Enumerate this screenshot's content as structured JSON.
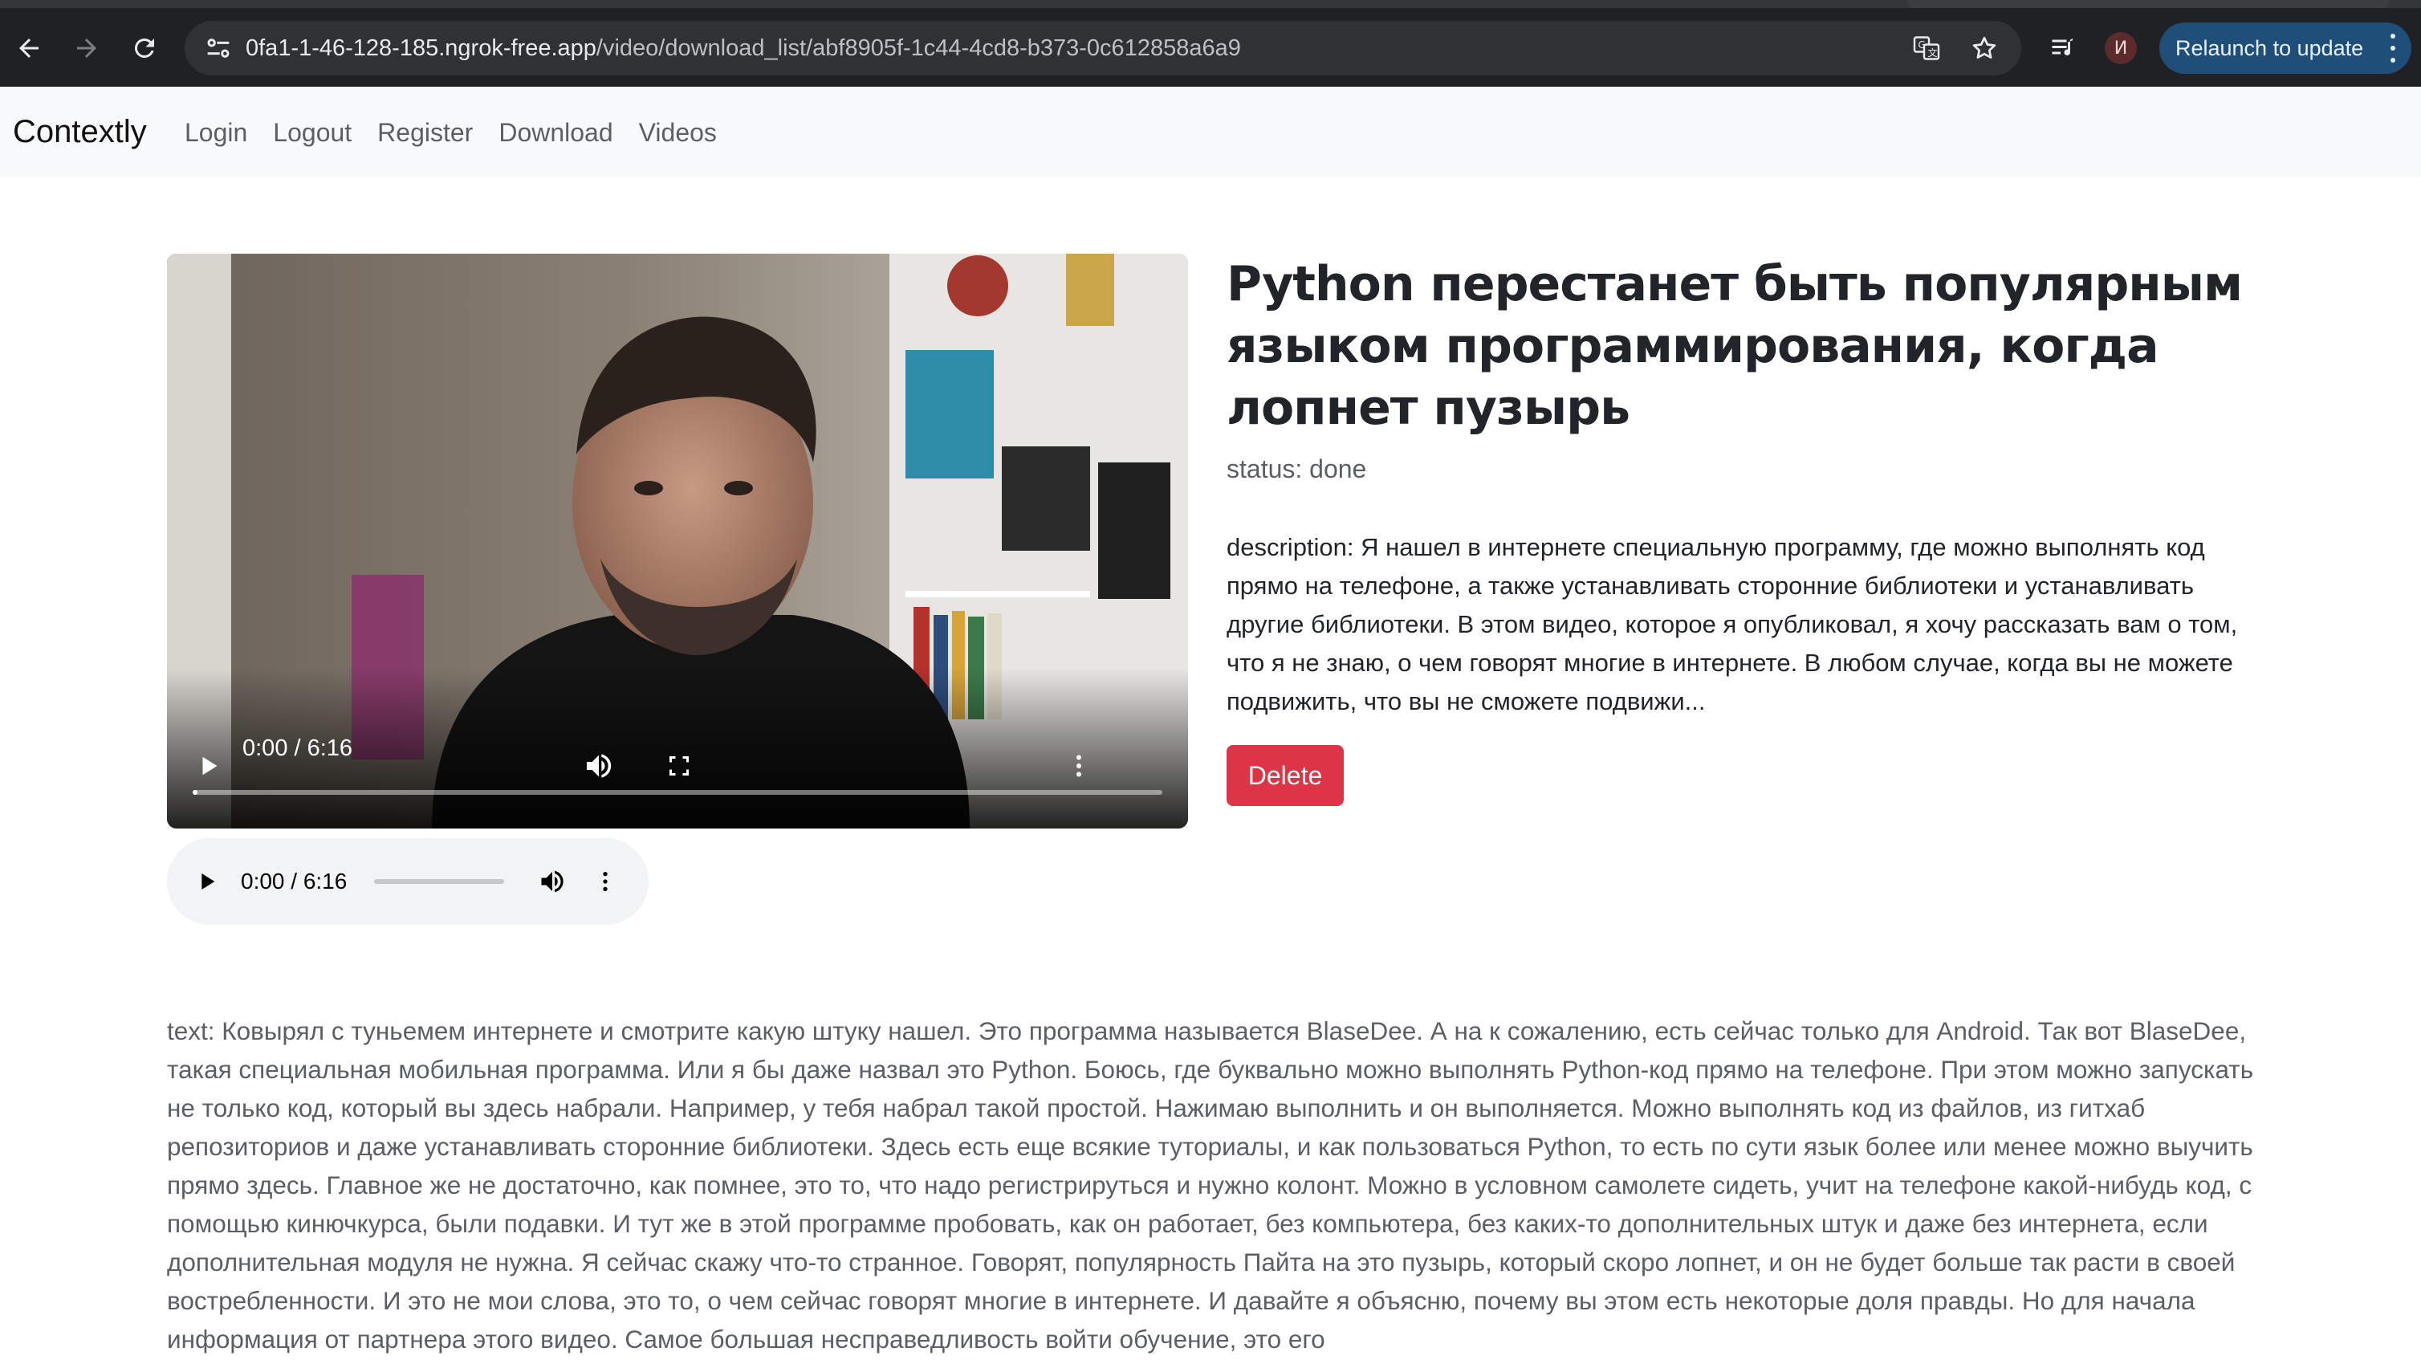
{
  "browser": {
    "url_host": "0fa1-1-46-128-185.ngrok-free.app",
    "url_path": "/video/download_list/abf8905f-1c44-4cd8-b373-0c612858a6a9",
    "profile_initial": "И",
    "relaunch_label": "Relaunch to update"
  },
  "navbar": {
    "brand": "Contextly",
    "links": [
      "Login",
      "Logout",
      "Register",
      "Download",
      "Videos"
    ]
  },
  "video": {
    "time": "0:00 / 6:16",
    "progress": 0.005
  },
  "audio": {
    "time": "0:00 / 6:16",
    "progress": 0.0
  },
  "item": {
    "title": "Python перестанет быть популярным языком программирования, когда лопнет пузырь",
    "status": "status: done",
    "description": "description: Я нашел в интернете специальную программу, где можно выполнять код прямо на телефоне, а также устанавливать сторонние библиотеки и устанавливать другие библиотеки. В этом видео, которое я опубликовал, я хочу рассказать вам о том, что я не знаю, о чем говорят многие в интернете. В любом случае, когда вы не можете подвижить, что вы не сможете подвижи...",
    "delete_label": "Delete",
    "text": "text: Ковырял с туньемем интернете и смотрите какую штуку нашел. Это программа называется BlaseDee. А на к сожалению, есть сейчас только для Android. Так вот BlaseDee, такая специальная мобильная программа. Или я бы даже назвал это Python. Боюсь, где буквально можно выполнять Python-код прямо на телефоне. При этом можно запускать не только код, который вы здесь набрали. Например, у тебя набрал такой простой. Нажимаю выполнить и он выполняется. Можно выполнять код из файлов, из гитхаб репозиториов и даже устанавливать сторонние библиотеки. Здесь есть еще всякие туториалы, и как пользоваться Python, то есть по сути язык более или менее можно выучить прямо здесь. Главное же не достаточно, как помнее, это то, что надо регистрируться и нужно колонт. Можно в условном самолете сидеть, учит на телефоне какой-нибудь код, с помощью кинючкурса, были подавки. И тут же в этой программе пробовать, как он работает, без компьютера, без каких-то дополнительных штук и даже без интернета, если дополнительная модуля не нужна. Я сейчас скажу что-то странное. Говорят, популярность Пайта на это пузырь, который скоро лопнет, и он не будет больше так расти в своей востребленности. И это не мои слова, это то, о чем сейчас говорят многие в интернете. И давайте я объясню, почему вы этом есть некоторые доля правды. Но для начала информация от партнера этого видео. Самое большая несправедливость войти обучение, это его"
  },
  "colors": {
    "delete": "#dc3545",
    "navbar_bg": "#f8f9fa",
    "relaunch_bg": "#1f4e79"
  }
}
